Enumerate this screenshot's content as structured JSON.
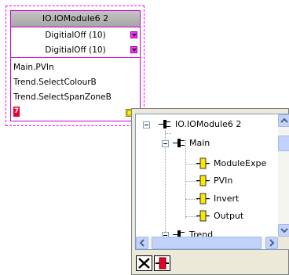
{
  "block": {
    "title": "IO.IOModule6 2",
    "params": [
      {
        "label": "DigitialOff (10)"
      },
      {
        "label": "DigitialOff (10)"
      }
    ],
    "wires": [
      "Main.PVIn",
      "Trend.SelectColourB",
      "Trend.SelectSpanZoneB"
    ],
    "indicator": "7"
  },
  "tree": {
    "items": [
      {
        "label": "IO.IOModule6 2"
      },
      {
        "label": "Main"
      },
      {
        "label": "ModuleExpe"
      },
      {
        "label": "PVIn"
      },
      {
        "label": "Invert"
      },
      {
        "label": "Output"
      },
      {
        "label": "Trend"
      }
    ]
  },
  "colors": {
    "block_border": "#cc00cc",
    "indicator": "#e8002a",
    "connector": "#ffe600"
  },
  "icons": {
    "dropdown": "chevron-down-icon",
    "connector": "connector-icon",
    "close": "close-icon",
    "disconnect": "disconnect-icon"
  }
}
